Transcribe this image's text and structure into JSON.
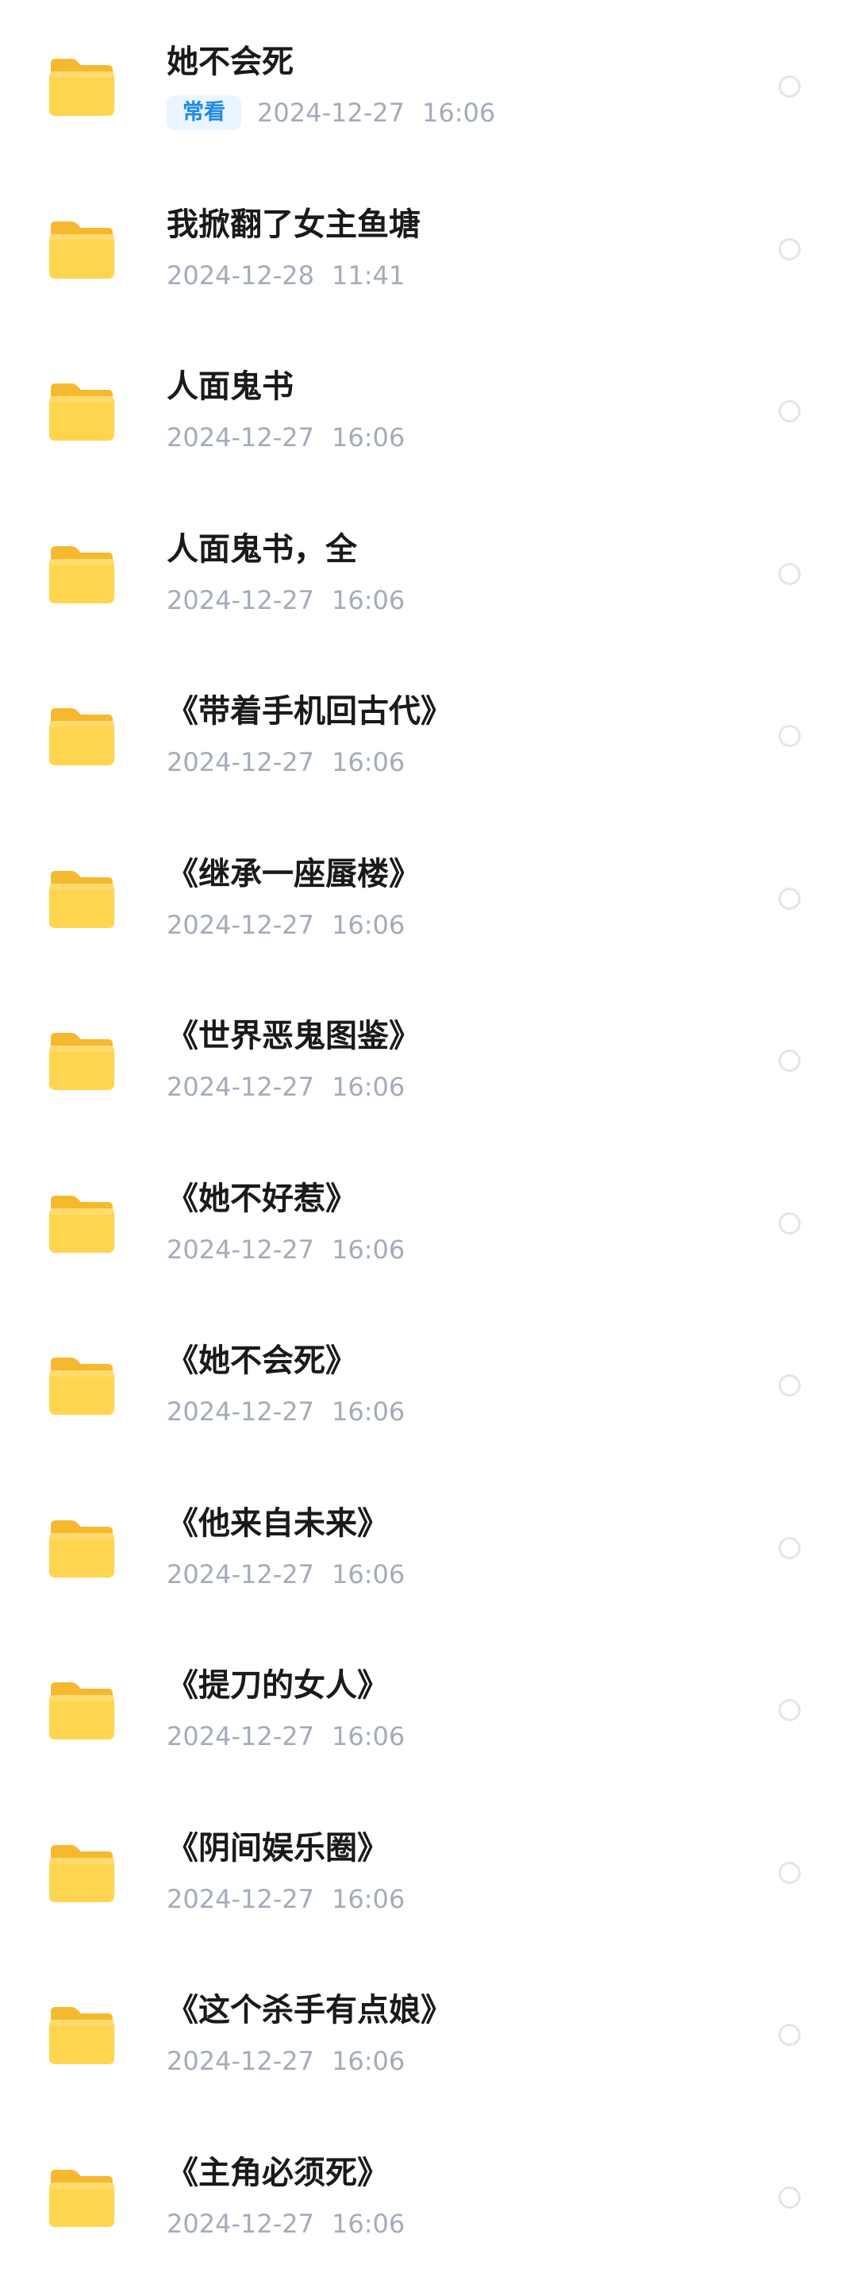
{
  "files": [
    {
      "name": "她不会死",
      "badge": "常看",
      "date": "2024-12-27",
      "time": "16:06"
    },
    {
      "name": "我掀翻了女主鱼塘",
      "badge": "",
      "date": "2024-12-28",
      "time": "11:41"
    },
    {
      "name": "人面鬼书",
      "badge": "",
      "date": "2024-12-27",
      "time": "16:06"
    },
    {
      "name": "人面鬼书，全",
      "badge": "",
      "date": "2024-12-27",
      "time": "16:06"
    },
    {
      "name": "《带着手机回古代》",
      "badge": "",
      "date": "2024-12-27",
      "time": "16:06"
    },
    {
      "name": "《继承一座蜃楼》",
      "badge": "",
      "date": "2024-12-27",
      "time": "16:06"
    },
    {
      "name": "《世界恶鬼图鉴》",
      "badge": "",
      "date": "2024-12-27",
      "time": "16:06"
    },
    {
      "name": "《她不好惹》",
      "badge": "",
      "date": "2024-12-27",
      "time": "16:06"
    },
    {
      "name": "《她不会死》",
      "badge": "",
      "date": "2024-12-27",
      "time": "16:06"
    },
    {
      "name": "《他来自未来》",
      "badge": "",
      "date": "2024-12-27",
      "time": "16:06"
    },
    {
      "name": "《提刀的女人》",
      "badge": "",
      "date": "2024-12-27",
      "time": "16:06"
    },
    {
      "name": "《阴间娱乐圈》",
      "badge": "",
      "date": "2024-12-27",
      "time": "16:06"
    },
    {
      "name": "《这个杀手有点娘》",
      "badge": "",
      "date": "2024-12-27",
      "time": "16:06"
    },
    {
      "name": "《主角必须死》",
      "badge": "",
      "date": "2024-12-27",
      "time": "16:06"
    }
  ],
  "icons": {
    "folder": "folder-icon",
    "select": "select-circle"
  },
  "colors": {
    "folder_front": "#FFD54F",
    "folder_back": "#F6B82E",
    "badge_text": "#1E88E5",
    "badge_bg": "#EAF5FF",
    "meta_text": "#A3ACB9"
  }
}
